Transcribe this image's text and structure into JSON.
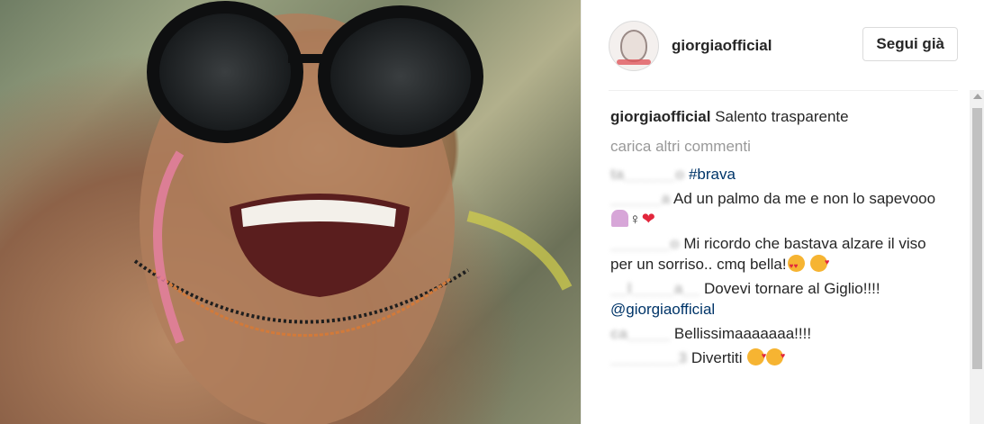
{
  "header": {
    "username": "giorgiaofficial",
    "follow_label": "Segui già"
  },
  "caption": {
    "username": "giorgiaofficial",
    "text": "Salento trasparente"
  },
  "load_more": "carica altri commenti",
  "comments": [
    {
      "user": "ta______o",
      "parts": [
        {
          "type": "link",
          "text": "#brava"
        }
      ]
    },
    {
      "user": "______a",
      "parts": [
        {
          "type": "text",
          "text": "Ad un palmo da me e non lo sapevooo"
        }
      ],
      "emojis": [
        "person-icon",
        "female-sign-icon",
        "heart-icon"
      ]
    },
    {
      "user": "_______o",
      "parts": [
        {
          "type": "text",
          "text": "Mi ricordo che bastava alzare il viso per un sorriso.. cmq bella!"
        }
      ],
      "emojis": [
        "heart-eyes-icon",
        "kiss-icon"
      ]
    },
    {
      "user": "__l_____a__",
      "parts": [
        {
          "type": "text",
          "text": "Dovevi tornare al Giglio!!!! "
        },
        {
          "type": "link",
          "text": "@giorgiaofficial"
        }
      ]
    },
    {
      "user": "ca_____",
      "parts": [
        {
          "type": "text",
          "text": "Bellissimaaaaaaa!!!!"
        }
      ]
    },
    {
      "user": "________3",
      "parts": [
        {
          "type": "text",
          "text": "Divertiti"
        }
      ],
      "emojis": [
        "kiss-icon",
        "kiss-icon"
      ]
    }
  ],
  "colors": {
    "text": "#262626",
    "muted": "#999999",
    "link": "#003569",
    "border": "#dbdbdb"
  }
}
